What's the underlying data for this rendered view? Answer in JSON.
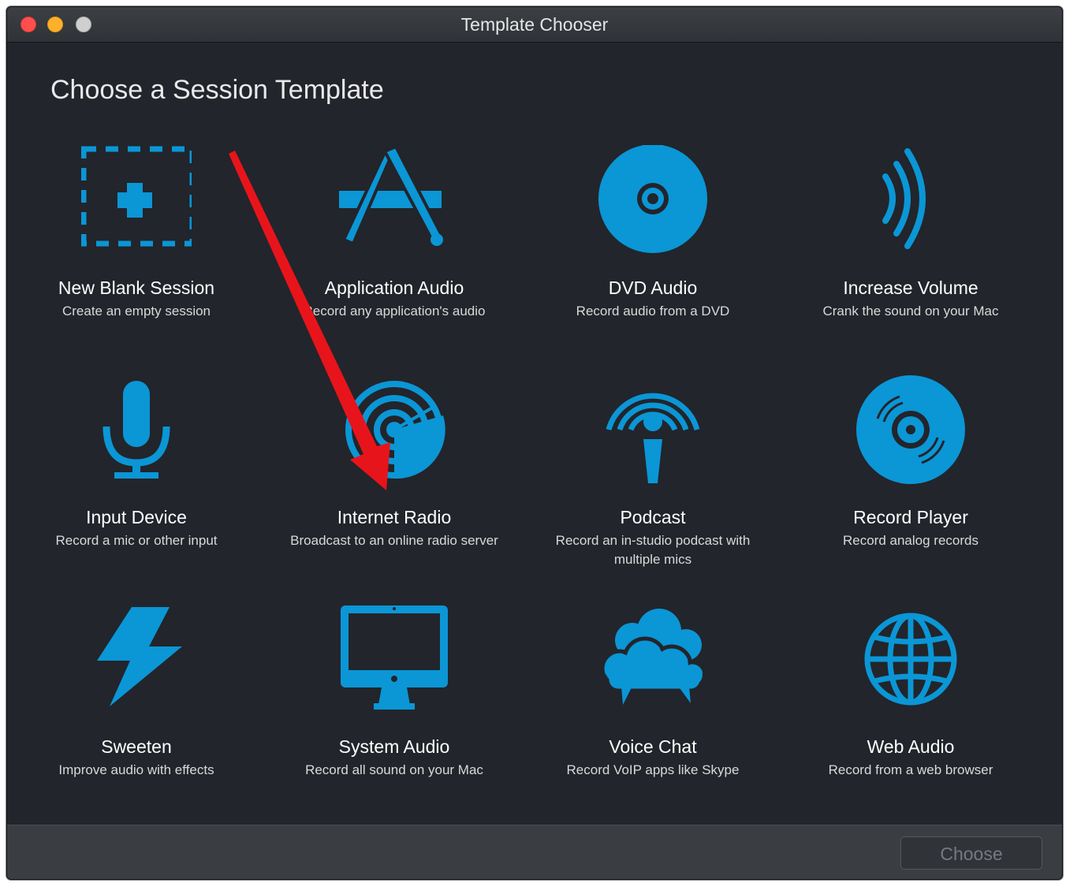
{
  "window": {
    "title": "Template Chooser"
  },
  "heading": "Choose a Session Template",
  "accent_color": "#0b96d6",
  "templates": [
    {
      "icon": "new-blank-session-icon",
      "title": "New Blank Session",
      "desc": "Create an empty session"
    },
    {
      "icon": "application-audio-icon",
      "title": "Application Audio",
      "desc": "Record any application's audio"
    },
    {
      "icon": "dvd-icon",
      "title": "DVD Audio",
      "desc": "Record audio from a DVD"
    },
    {
      "icon": "volume-waves-icon",
      "title": "Increase Volume",
      "desc": "Crank the sound on your Mac"
    },
    {
      "icon": "microphone-icon",
      "title": "Input Device",
      "desc": "Record a mic or other input"
    },
    {
      "icon": "radar-icon",
      "title": "Internet Radio",
      "desc": "Broadcast to an online radio server"
    },
    {
      "icon": "podcast-icon",
      "title": "Podcast",
      "desc": "Record an in-studio podcast with multiple mics"
    },
    {
      "icon": "vinyl-record-icon",
      "title": "Record Player",
      "desc": "Record analog records"
    },
    {
      "icon": "lightning-bolt-icon",
      "title": "Sweeten",
      "desc": "Improve audio with effects"
    },
    {
      "icon": "monitor-icon",
      "title": "System Audio",
      "desc": "Record all sound on your Mac"
    },
    {
      "icon": "clouds-icon",
      "title": "Voice Chat",
      "desc": "Record VoIP apps like Skype"
    },
    {
      "icon": "globe-icon",
      "title": "Web Audio",
      "desc": "Record from a web browser"
    }
  ],
  "footer": {
    "choose_label": "Choose"
  },
  "annotation_color": "#e8141b"
}
